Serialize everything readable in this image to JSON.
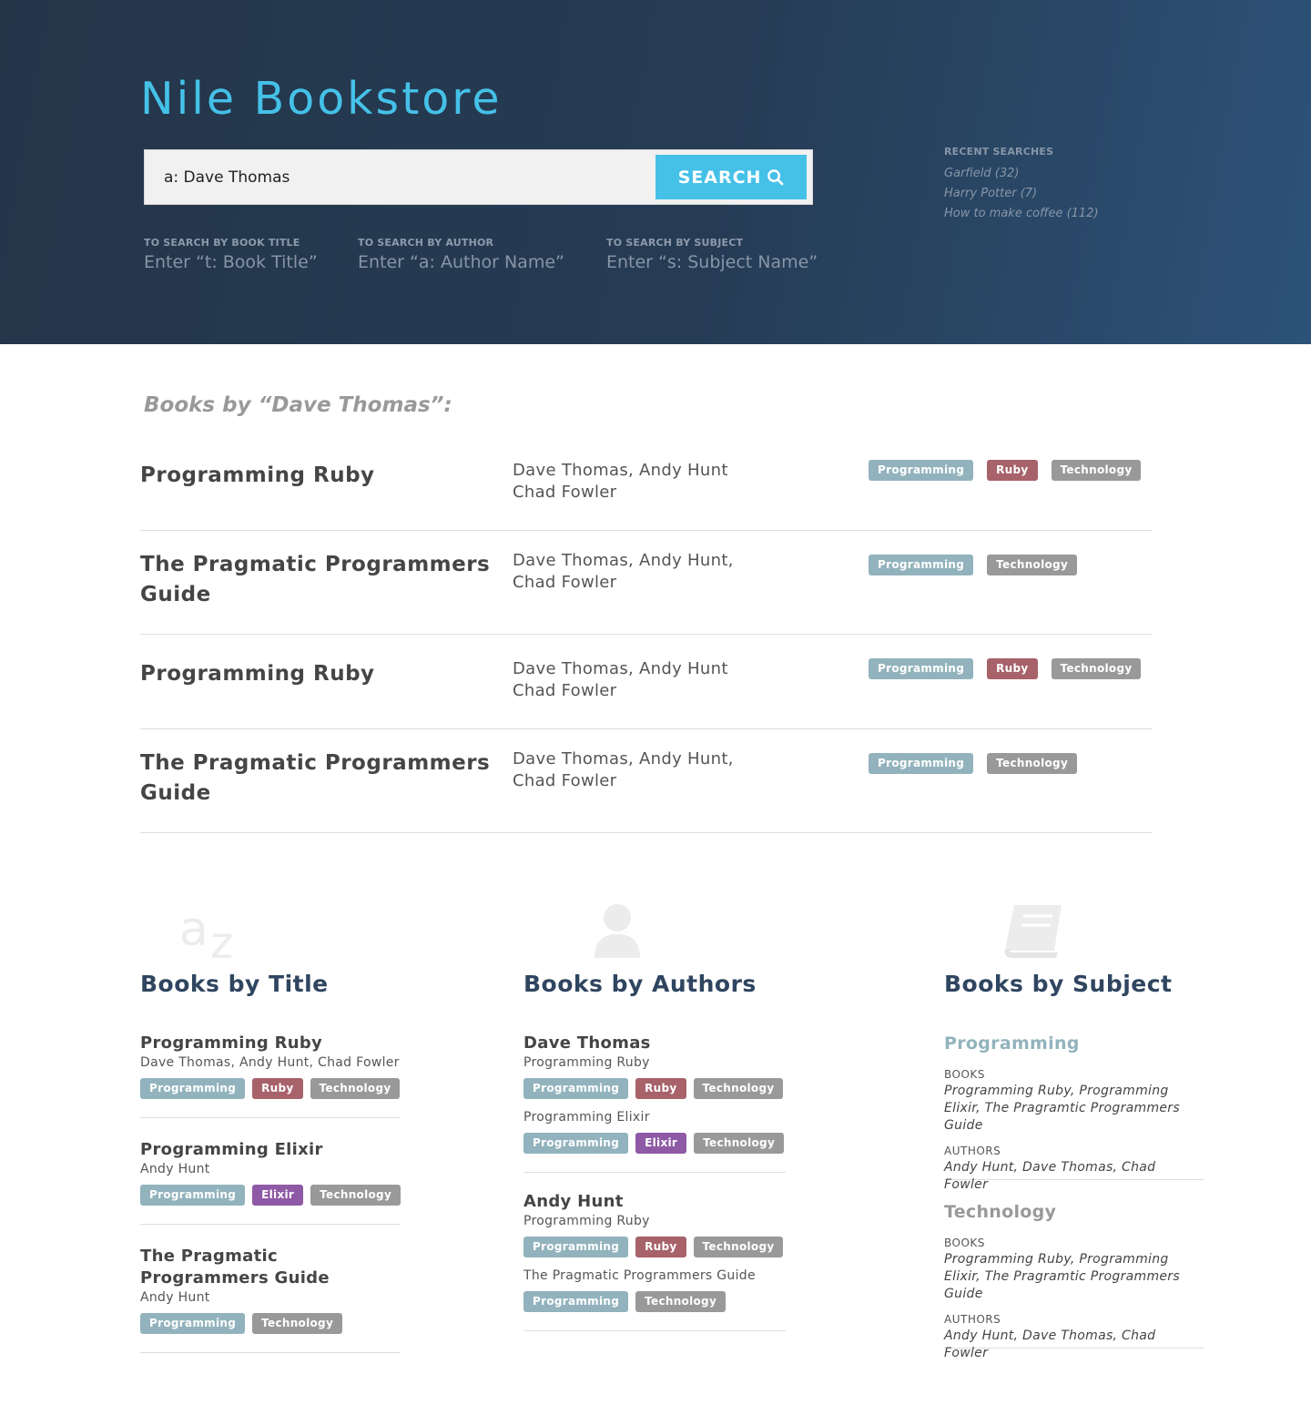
{
  "header": {
    "brand": "Nile Bookstore",
    "search": {
      "value": "a: Dave Thomas",
      "button_label": "SEARCH"
    },
    "hints": [
      {
        "label": "TO SEARCH BY BOOK TITLE",
        "text": "Enter “t: Book Title”"
      },
      {
        "label": "TO SEARCH BY AUTHOR",
        "text": "Enter “a: Author Name”"
      },
      {
        "label": "TO SEARCH BY SUBJECT",
        "text": "Enter “s: Subject Name”"
      }
    ],
    "recent": {
      "label": "RECENT SEARCHES",
      "items": [
        "Garfield (32)",
        "Harry Potter (7)",
        "How to make coffee (112)"
      ]
    }
  },
  "results": {
    "heading": "Books by “Dave Thomas”:",
    "rows": [
      {
        "title": "Programming Ruby",
        "authors_line1": "Dave Thomas, Andy Hunt",
        "authors_line2": "Chad Fowler",
        "tags": [
          "Programming",
          "Ruby",
          "Technology"
        ]
      },
      {
        "title": "The Pragmatic Programmers Guide",
        "authors_line1": "Dave Thomas, Andy Hunt,",
        "authors_line2": "Chad Fowler",
        "tags": [
          "Programming",
          "Technology"
        ]
      },
      {
        "title": "Programming Ruby",
        "authors_line1": "Dave Thomas, Andy Hunt",
        "authors_line2": "Chad Fowler",
        "tags": [
          "Programming",
          "Ruby",
          "Technology"
        ]
      },
      {
        "title": "The Pragmatic Programmers Guide",
        "authors_line1": "Dave Thomas, Andy Hunt,",
        "authors_line2": "Chad Fowler",
        "tags": [
          "Programming",
          "Technology"
        ]
      }
    ]
  },
  "by_title": {
    "heading": "Books by Title",
    "items": [
      {
        "title": "Programming Ruby",
        "authors": "Dave Thomas, Andy Hunt, Chad Fowler",
        "tags": [
          "Programming",
          "Ruby",
          "Technology"
        ]
      },
      {
        "title": "Programming Elixir",
        "authors": "Andy Hunt",
        "tags": [
          "Programming",
          "Elixir",
          "Technology"
        ]
      },
      {
        "title": "The Pragmatic Programmers Guide",
        "authors": "Andy Hunt",
        "tags": [
          "Programming",
          "Technology"
        ]
      }
    ]
  },
  "by_authors": {
    "heading": "Books by Authors",
    "items": [
      {
        "name": "Dave Thomas",
        "books": [
          {
            "title": "Programming Ruby",
            "tags": [
              "Programming",
              "Ruby",
              "Technology"
            ]
          },
          {
            "title": "Programming Elixir",
            "tags": [
              "Programming",
              "Elixir",
              "Technology"
            ]
          }
        ]
      },
      {
        "name": "Andy Hunt",
        "books": [
          {
            "title": "Programming Ruby",
            "tags": [
              "Programming",
              "Ruby",
              "Technology"
            ]
          },
          {
            "title": "The Pragmatic Programmers Guide",
            "tags": [
              "Programming",
              "Technology"
            ]
          }
        ]
      }
    ]
  },
  "by_subject": {
    "heading": "Books by Subject",
    "items": [
      {
        "subject": "Programming",
        "color": "#92b3bd",
        "books_label": "BOOKS",
        "books": "Programming Ruby, Programming Elixir, The Pragramtic Programmers Guide",
        "authors_label": "AUTHORS",
        "authors": "Andy Hunt, Dave Thomas, Chad Fowler"
      },
      {
        "subject": "Technology",
        "color": "#999999",
        "books_label": "BOOKS",
        "books": "Programming Ruby, Programming Elixir, The Pragramtic Programmers Guide",
        "authors_label": "AUTHORS",
        "authors": "Andy Hunt, Dave Thomas, Chad Fowler"
      }
    ]
  },
  "colors": {
    "brand": "#45c1e8",
    "header_bg": "#253a51",
    "tag_programming": "#92b3bd",
    "tag_ruby": "#a7626a",
    "tag_technology": "#999999",
    "tag_elixir": "#8e5aa6"
  },
  "icons": {
    "title_column": "az-icon",
    "authors_column": "user-icon",
    "subject_column": "book-icon",
    "search_button": "search-icon"
  }
}
